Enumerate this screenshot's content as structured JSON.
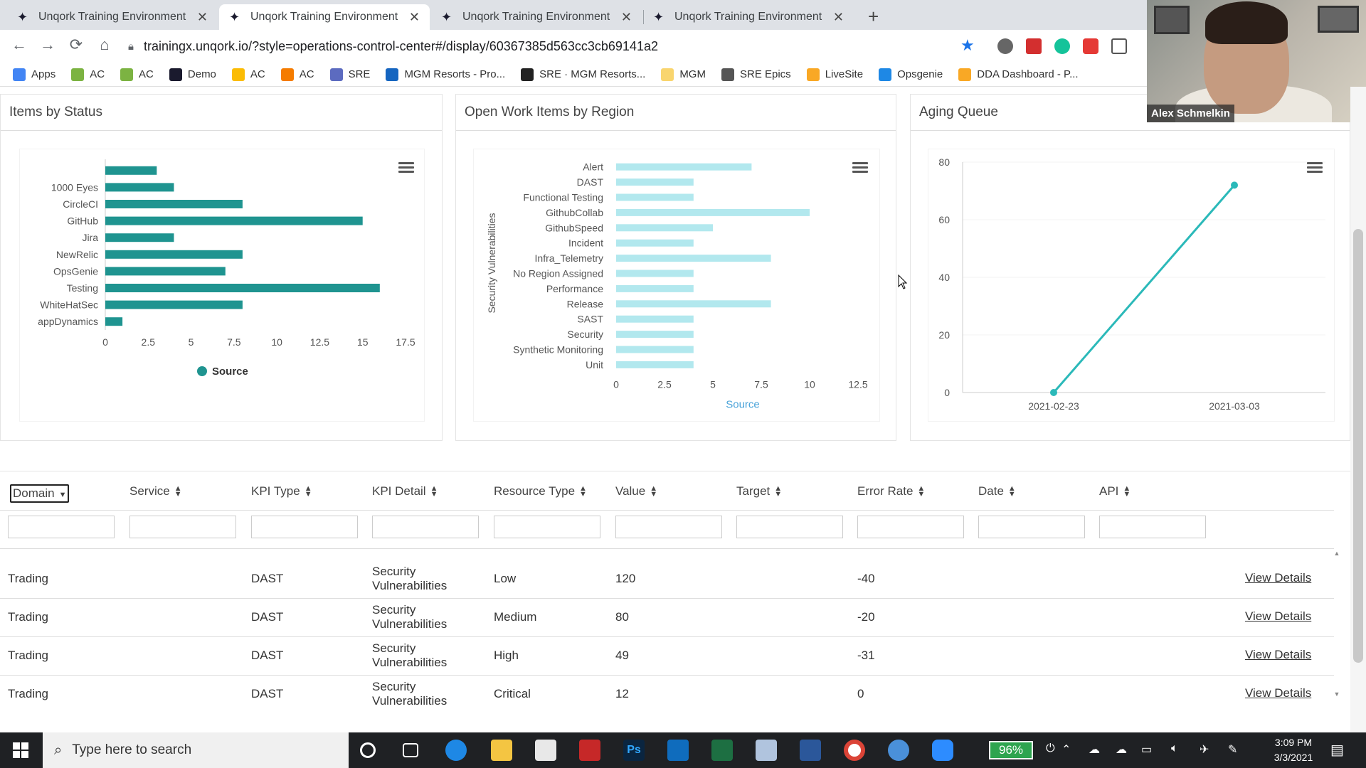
{
  "browser": {
    "tabs": [
      {
        "title": "Unqork Training Environment",
        "active": false
      },
      {
        "title": "Unqork Training Environment",
        "active": true
      },
      {
        "title": "Unqork Training Environment",
        "active": false
      },
      {
        "title": "Unqork Training Environment",
        "active": false
      }
    ],
    "url": "trainingx.unqork.io/?style=operations-control-center#/display/60367385d563cc3cb69141a2",
    "bookmarks": [
      {
        "label": "Apps",
        "color": "#4285f4"
      },
      {
        "label": "AC",
        "color": "#7cb342"
      },
      {
        "label": "AC",
        "color": "#7cb342"
      },
      {
        "label": "Demo",
        "color": "#1a1a2e"
      },
      {
        "label": "AC",
        "color": "#fbbc04"
      },
      {
        "label": "AC",
        "color": "#f57c00"
      },
      {
        "label": "SRE",
        "color": "#5c6bc0"
      },
      {
        "label": "MGM Resorts - Pro...",
        "color": "#1565c0"
      },
      {
        "label": "SRE · MGM Resorts...",
        "color": "#222222"
      },
      {
        "label": "MGM",
        "color": "#f9d56e"
      },
      {
        "label": "SRE Epics",
        "color": "#555555"
      },
      {
        "label": "LiveSite",
        "color": "#f9a825"
      },
      {
        "label": "Opsgenie",
        "color": "#1e88e5"
      },
      {
        "label": "DDA Dashboard - P...",
        "color": "#f9a825"
      }
    ]
  },
  "webcam": {
    "name": "Alex Schmelkin"
  },
  "panels": {
    "items_by_status": {
      "title": "Items by Status"
    },
    "open_work_items": {
      "title": "Open Work Items by Region"
    },
    "aging_queue": {
      "title": "Aging Queue"
    }
  },
  "chart_data": [
    {
      "type": "bar",
      "orientation": "horizontal",
      "categories": [
        "",
        "1000 Eyes",
        "CircleCI",
        "GitHub",
        "Jira",
        "NewRelic",
        "OpsGenie",
        "Testing",
        "WhiteHatSec",
        "appDynamics"
      ],
      "values": [
        3,
        4,
        8,
        15,
        4,
        8,
        7,
        16,
        8,
        1
      ],
      "xticks": [
        "0",
        "2.5",
        "5",
        "7.5",
        "10",
        "12.5",
        "15",
        "17.5"
      ],
      "xlim": [
        0,
        17.5
      ],
      "legend": [
        "Source"
      ],
      "color": "#1f9490"
    },
    {
      "type": "bar",
      "orientation": "horizontal",
      "categories": [
        "Alert",
        "DAST",
        "Functional Testing",
        "GithubCollab",
        "GithubSpeed",
        "Incident",
        "Infra_Telemetry",
        "No Region Assigned",
        "Performance",
        "Release",
        "SAST",
        "Security",
        "Synthetic Monitoring",
        "Unit"
      ],
      "values": [
        7,
        4,
        4,
        10,
        5,
        4,
        8,
        4,
        4,
        8,
        4,
        4,
        4,
        4
      ],
      "xticks": [
        "0",
        "2.5",
        "5",
        "7.5",
        "10",
        "12.5"
      ],
      "xlim": [
        0,
        12.5
      ],
      "ylabel": "Security Vulnerabilities",
      "xlabel": "Source",
      "color": "#b2e8ee"
    },
    {
      "type": "line",
      "x": [
        "2021-02-23",
        "2021-03-03"
      ],
      "values": [
        0,
        72
      ],
      "yticks": [
        "0",
        "20",
        "40",
        "60",
        "80"
      ],
      "ylim": [
        0,
        80
      ],
      "color": "#2bb9b9"
    }
  ],
  "table": {
    "columns": [
      "Domain",
      "Service",
      "KPI Type",
      "KPI Detail",
      "Resource Type",
      "Value",
      "Target",
      "Error Rate",
      "Date",
      "API"
    ],
    "link_label": "View Details",
    "rows": [
      {
        "domain": "Trading",
        "kpi_type": "DAST",
        "kpi_detail_1": "Security",
        "kpi_detail_2": "Vulnerabilities",
        "resource_type": "Low",
        "value": "120",
        "error_rate": "-40"
      },
      {
        "domain": "Trading",
        "kpi_type": "DAST",
        "kpi_detail_1": "Security",
        "kpi_detail_2": "Vulnerabilities",
        "resource_type": "Medium",
        "value": "80",
        "error_rate": "-20"
      },
      {
        "domain": "Trading",
        "kpi_type": "DAST",
        "kpi_detail_1": "Security",
        "kpi_detail_2": "Vulnerabilities",
        "resource_type": "High",
        "value": "49",
        "error_rate": "-31"
      },
      {
        "domain": "Trading",
        "kpi_type": "DAST",
        "kpi_detail_1": "Security",
        "kpi_detail_2": "Vulnerabilities",
        "resource_type": "Critical",
        "value": "12",
        "error_rate": "0"
      }
    ]
  },
  "taskbar": {
    "search_placeholder": "Type here to search",
    "battery": "96%",
    "time": "3:09 PM",
    "date": "3/3/2021"
  }
}
